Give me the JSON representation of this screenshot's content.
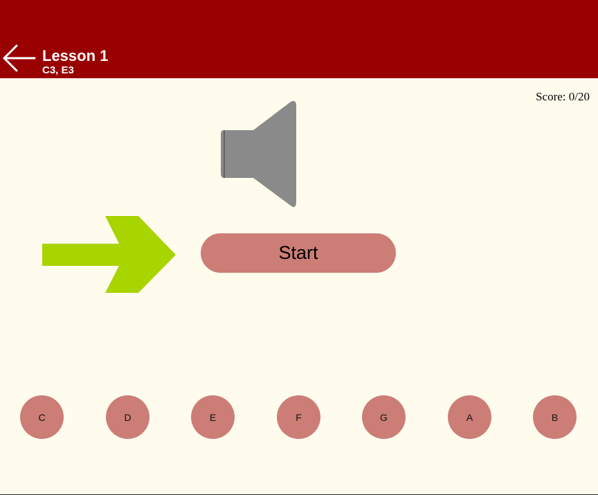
{
  "header": {
    "title": "Lesson 1",
    "subtitle": "C3, E3",
    "back_icon": "arrow-left-icon",
    "background_color": "#990000"
  },
  "score": {
    "label": "Score: ",
    "value": "0/20"
  },
  "speaker": {
    "icon": "speaker-icon",
    "color": "#8a8a8a"
  },
  "hint_arrow": {
    "icon": "arrow-right-icon",
    "color": "#a8d400"
  },
  "start_button": {
    "label": "Start",
    "color": "#cc7d76"
  },
  "notes": [
    {
      "label": "C"
    },
    {
      "label": "D"
    },
    {
      "label": "E"
    },
    {
      "label": "F"
    },
    {
      "label": "G"
    },
    {
      "label": "A"
    },
    {
      "label": "B"
    }
  ],
  "colors": {
    "background": "#fffcee",
    "note_button": "#cc7d76"
  }
}
